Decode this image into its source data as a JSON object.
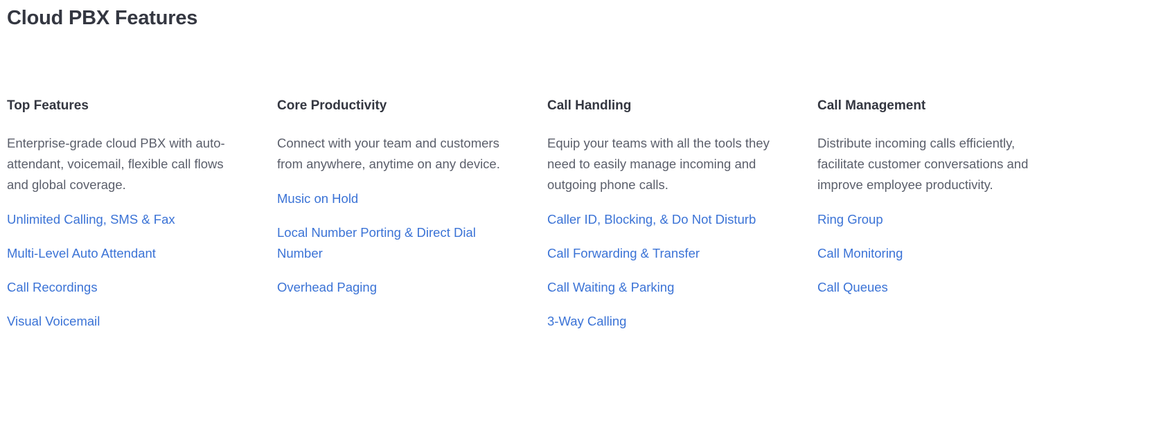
{
  "page": {
    "title": "Cloud PBX Features",
    "accent_link_color": "#3b73d6",
    "heading_color": "#343741",
    "body_text_color": "#5b5f6b",
    "background_color": "#ffffff"
  },
  "columns": [
    {
      "title": "Top Features",
      "description": "Enterprise-grade cloud PBX with auto-attendant, voicemail, flexible call flows and global coverage.",
      "links": [
        "Unlimited Calling, SMS & Fax",
        "Multi-Level Auto Attendant",
        "Call Recordings",
        "Visual Voicemail"
      ]
    },
    {
      "title": "Core Productivity",
      "description": "Connect with your team and customers from anywhere, anytime on any device.",
      "links": [
        "Music on Hold",
        "Local Number Porting & Direct Dial Number",
        "Overhead Paging"
      ]
    },
    {
      "title": "Call Handling",
      "description": "Equip your teams with all the tools they need to easily manage incoming and outgoing phone calls.",
      "links": [
        "Caller ID, Blocking, & Do Not Disturb",
        "Call Forwarding & Transfer",
        "Call Waiting & Parking",
        "3-Way Calling"
      ]
    },
    {
      "title": "Call Management",
      "description": "Distribute incoming calls efficiently, facilitate customer conversations and improve employee productivity.",
      "links": [
        "Ring Group",
        "Call Monitoring",
        "Call Queues"
      ]
    }
  ]
}
